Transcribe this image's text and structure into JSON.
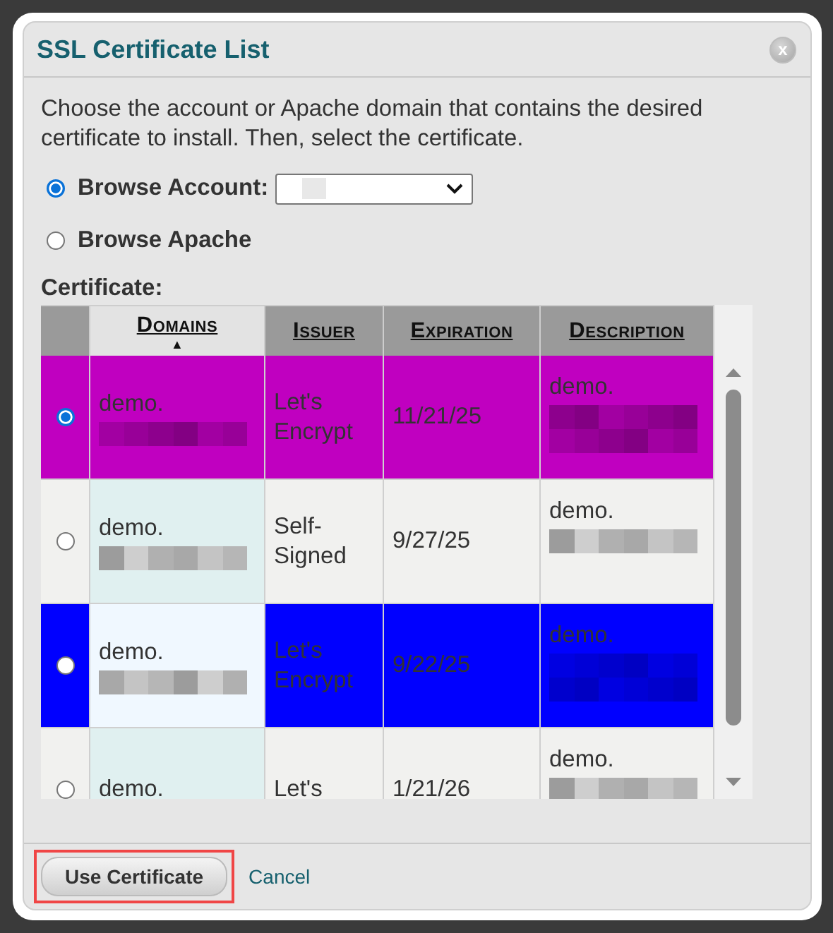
{
  "dialog": {
    "title": "SSL Certificate List",
    "close": "x"
  },
  "instructions": "Choose the account or Apache domain that contains the desired certificate to install. Then, select the certificate.",
  "sources": [
    {
      "label": "Browse Account:",
      "selected": true,
      "kind": "select",
      "redacted": true
    },
    {
      "label": "Browse Apache",
      "selected": false,
      "kind": "plain"
    }
  ],
  "table": {
    "label": "Certificate:",
    "columns": [
      {
        "label": "Domains",
        "sorted": true,
        "sort_arrow": "▲"
      },
      {
        "label": "Issuer",
        "sorted": false
      },
      {
        "label": "Expiration",
        "sorted": false
      },
      {
        "label": "Description",
        "sorted": false
      }
    ],
    "rows": [
      {
        "selected": true,
        "color": "#c000c0",
        "domain": "demo.",
        "domain_redacted": true,
        "issuer": "Let's Encrypt",
        "expiration": "11/21/25",
        "description": "demo.",
        "description_redacted": true
      },
      {
        "selected": false,
        "domain": "demo.",
        "domain_redacted": true,
        "issuer": "Self-Signed",
        "expiration": "9/27/25",
        "description": "demo.",
        "description_redacted": true
      },
      {
        "selected": false,
        "color": "#0000ff",
        "domain": "demo.",
        "domain_redacted": true,
        "issuer": "Let's Encrypt",
        "expiration": "9/22/25",
        "description": "demo.",
        "description_redacted": true
      },
      {
        "selected": false,
        "domain": "demo.",
        "domain_redacted": false,
        "issuer": "Let's",
        "expiration": "1/21/26",
        "description": "demo.",
        "description_redacted": true
      }
    ]
  },
  "footer": {
    "primary": "Use Certificate",
    "primary_highlighted": true,
    "cancel": "Cancel"
  }
}
